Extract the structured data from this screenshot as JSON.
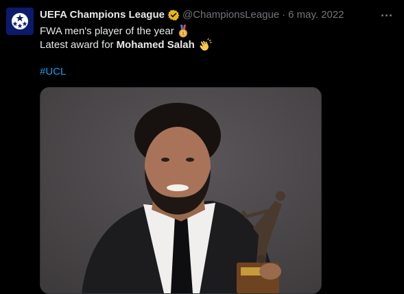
{
  "tweet": {
    "author_name": "UEFA Champions League",
    "handle": "@ChampionsLeague",
    "separator": "·",
    "date": "6 may. 2022",
    "line1": "FWA men's player of the year",
    "line2_prefix": "Latest award for",
    "line2_bold": "Mohamed Salah",
    "hashtag": "#UCL"
  },
  "icons": {
    "avatar": "ucl-starball-logo",
    "verified": "gold-verified-badge-icon",
    "more": "more-options-icon",
    "medal": "medal-emoji",
    "clap": "clapping-hands-emoji"
  },
  "colors": {
    "background": "#000000",
    "text": "#e7e9ea",
    "muted": "#71767b",
    "link": "#1d9bf0",
    "verified": "#e2b719"
  }
}
